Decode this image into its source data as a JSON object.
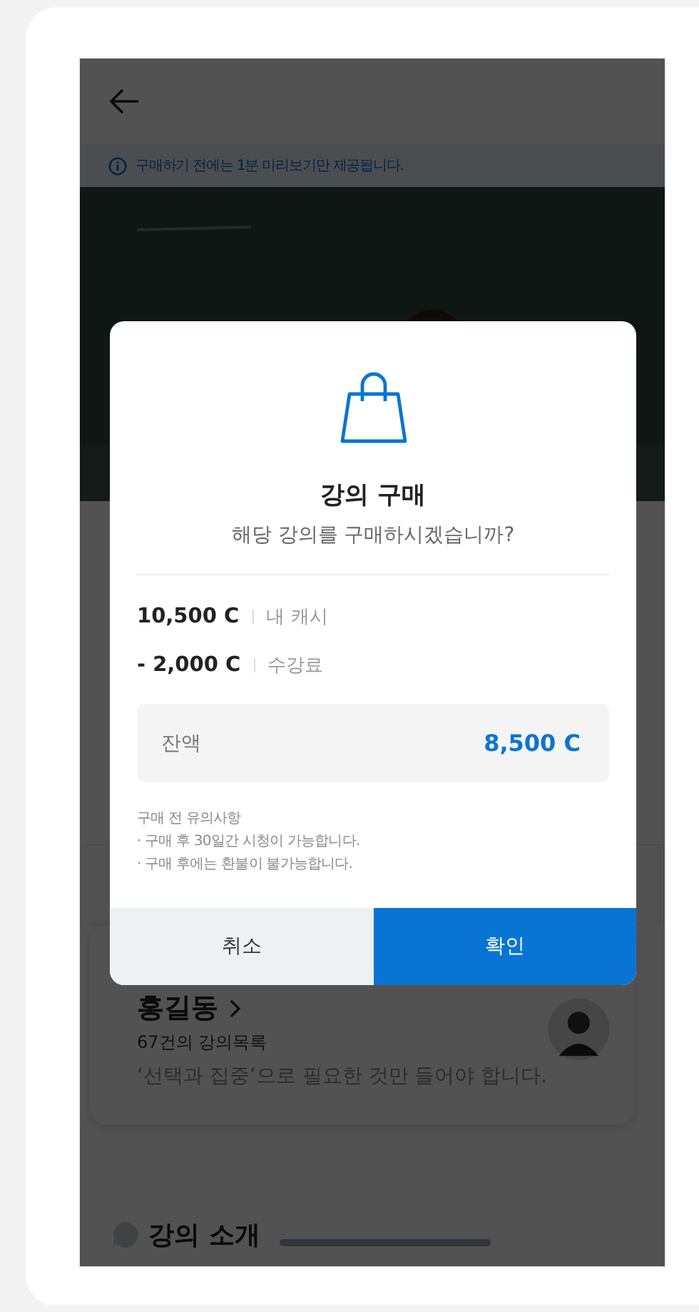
{
  "notice": "구매하기 전에는 1분 미리보기만 제공됩니다.",
  "instructor": {
    "name": "홍길동",
    "lecture_count": "67건의 강의목록",
    "quote": "‘선택과 집중’으로 필요한 것만 들어야 합니다."
  },
  "section_title": "강의 소개",
  "dialog": {
    "title": "강의 구매",
    "message": "해당 강의를 구매하시겠습니까?",
    "lines": [
      {
        "amount": "10,500 C",
        "label": "내 캐시"
      },
      {
        "amount": "- 2,000 C",
        "label": "수강료"
      }
    ],
    "balance": {
      "label": "잔액",
      "amount": "8,500 C"
    },
    "notes": [
      "구매 전 유의사항",
      "· 구매 후 30일간 시청이 가능합니다.",
      "· 구매 후에는 환불이 불가능합니다."
    ],
    "buttons": [
      {
        "label": "취소",
        "kind": "secondary"
      },
      {
        "label": "확인",
        "kind": "primary"
      }
    ]
  }
}
